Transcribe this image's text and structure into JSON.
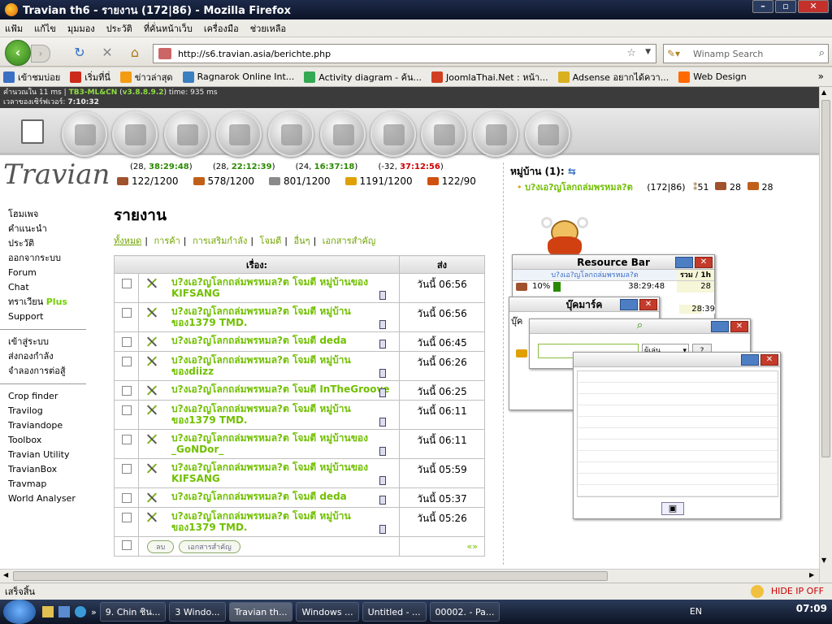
{
  "window": {
    "title": "Travian th6 - รายงาน (172|86) - Mozilla Firefox"
  },
  "menu": [
    "แฟ้ม",
    "แก้ไข",
    "มุมมอง",
    "ประวัติ",
    "ที่คั่นหน้าเว็บ",
    "เครื่องมือ",
    "ช่วยเหลือ"
  ],
  "nav": {
    "url": "http://s6.travian.asia/berichte.php",
    "search_placeholder": "Winamp Search"
  },
  "bookmarks": [
    {
      "label": "เข้าชมบ่อย",
      "color": "#3b6fc4"
    },
    {
      "label": "เริ่มที่นี่",
      "color": "#cc2a1a"
    },
    {
      "label": "ข่าวล่าสุด",
      "color": "#f39c12"
    },
    {
      "label": "Ragnarok Online Int...",
      "color": "#3a7fc0"
    },
    {
      "label": "Activity diagram - ค้น...",
      "color": "#34a853"
    },
    {
      "label": "JoomlaThai.Net : หน้า...",
      "color": "#d04020"
    },
    {
      "label": "Adsense อยากได้ควา...",
      "color": "#d8b020"
    },
    {
      "label": "Web Design",
      "color": "#ff6a00"
    }
  ],
  "debug": {
    "line1_pre": "คำนวณใน 11 ms |",
    "version": "TB3-ML&CN",
    "ver_num": "v3.8.8.9.2",
    "line1_post": "time: 935 ms",
    "line2_pre": "เวลาของเซิร์ฟเวอร์:",
    "server_time": "7:10:32"
  },
  "logo": "Travian",
  "sidebar": {
    "group1": [
      "โฮมเพจ",
      "คำแนะนำ",
      "ประวัติ",
      "ออกจากระบบ",
      "Forum",
      "Chat"
    ],
    "plus_pre": "ทราเวียน",
    "plus": "Plus",
    "support": "Support",
    "group2": [
      "เข้าสู่ระบบ",
      "ส่งกองกำลัง",
      "จำลองการต่อสู้"
    ],
    "group3": [
      "Crop finder",
      "Travilog",
      "Traviandope",
      "Toolbox",
      "Travian Utility",
      "TravianBox",
      "Travmap",
      "World Analyser"
    ]
  },
  "resources": [
    {
      "time_pre": "(28, ",
      "time": "38:29:48",
      "time_post": ")",
      "tcolor": "green",
      "value": "122/1200",
      "color": "#a0522d"
    },
    {
      "time_pre": "(28, ",
      "time": "22:12:39",
      "time_post": ")",
      "tcolor": "green",
      "value": "578/1200",
      "color": "#c06018"
    },
    {
      "time_pre": "(24, ",
      "time": "16:37:18",
      "time_post": ")",
      "tcolor": "green",
      "value": "801/1200",
      "color": "#8a8a8a"
    },
    {
      "time_pre": "(-32, ",
      "time": "37:12:56",
      "time_post": ")",
      "tcolor": "red",
      "value": "1191/1200",
      "color": "#e0a000"
    },
    {
      "time_pre": "",
      "time": "",
      "time_post": "",
      "tcolor": "green",
      "value": "122/90",
      "color": "#d05010"
    }
  ],
  "page": {
    "heading": "รายงาน",
    "filters": [
      "ทั้งหมด",
      "การค้า",
      "การเสริมกำลัง",
      "โจมตี",
      "อื่นๆ",
      "เอกสารสำคัญ"
    ]
  },
  "reports": {
    "col_subject": "เรื่อง:",
    "col_sent": "ส่ง",
    "rows": [
      {
        "l1": "บ?งเอ?ญโลกถล่มพรหมล?ต โจมตี หมู่บ้านของ",
        "l2": "KIFSANG",
        "time": "วันนี้ 06:56"
      },
      {
        "l1": "บ?งเอ?ญโลกถล่มพรหมล?ต โจมตี หมู่บ้าน",
        "l2": "ของ1379 TMD.",
        "time": "วันนี้ 06:56"
      },
      {
        "l1": "บ?งเอ?ญโลกถล่มพรหมล?ต โจมตี deda",
        "l2": "",
        "time": "วันนี้ 06:45"
      },
      {
        "l1": "บ?งเอ?ญโลกถล่มพรหมล?ต โจมตี หมู่บ้าน",
        "l2": "ของdiizz",
        "time": "วันนี้ 06:26"
      },
      {
        "l1": "บ?งเอ?ญโลกถล่มพรหมล?ต โจมตี InTheGroove",
        "l2": "",
        "time": "วันนี้ 06:25"
      },
      {
        "l1": "บ?งเอ?ญโลกถล่มพรหมล?ต โจมตี หมู่บ้าน",
        "l2": "ของ1379 TMD.",
        "time": "วันนี้ 06:11"
      },
      {
        "l1": "บ?งเอ?ญโลกถล่มพรหมล?ต โจมตี หมู่บ้านของ",
        "l2": "_GoNDor_",
        "time": "วันนี้ 06:11"
      },
      {
        "l1": "บ?งเอ?ญโลกถล่มพรหมล?ต โจมตี หมู่บ้านของ",
        "l2": "KIFSANG",
        "time": "วันนี้ 05:59"
      },
      {
        "l1": "บ?งเอ?ญโลกถล่มพรหมล?ต โจมตี deda",
        "l2": "",
        "time": "วันนี้ 05:37"
      },
      {
        "l1": "บ?งเอ?ญโลกถล่มพรหมล?ต โจมตี หมู่บ้าน",
        "l2": "ของ1379 TMD.",
        "time": "วันนี้ 05:26"
      }
    ],
    "btn_delete": "ลบ",
    "btn_archive": "เอกสารสำคัญ",
    "pager": "«»"
  },
  "village": {
    "heading": "หมู่บ้าน (1):",
    "name": "บ?งเอ?ญโลกถล่มพรหมล?ต",
    "coords": "(172|86)",
    "r1": "51",
    "r2": "28",
    "r3": "28"
  },
  "resource_bar": {
    "title": "Resource Bar",
    "village": "บ?งเอ?ญโลกถล่มพรหมล?ต",
    "col": "รวม / 1h",
    "percent_text": "10%",
    "fill_fraction": 0.1,
    "time1": "38:29:48",
    "val1": "28",
    "time2": ":39",
    "val2": "28"
  },
  "bookmark_popup": {
    "title": "บุ๊คมาร์ค",
    "stub": "บุ๊ค"
  },
  "search_popup": {
    "select": "ผู้เล่น",
    "q_btn": "?"
  },
  "extra": {
    "dash": "-"
  },
  "status": {
    "left": "เสร็จสิ้น",
    "hideip": "HIDE IP OFF"
  },
  "taskbar": {
    "items": [
      "9. Chin ชิน...",
      "3 Windo...",
      "Travian th...",
      "Windows ...",
      "Untitled - ...",
      "00002. - Pa..."
    ],
    "lang": "EN",
    "clock": "07:09"
  }
}
